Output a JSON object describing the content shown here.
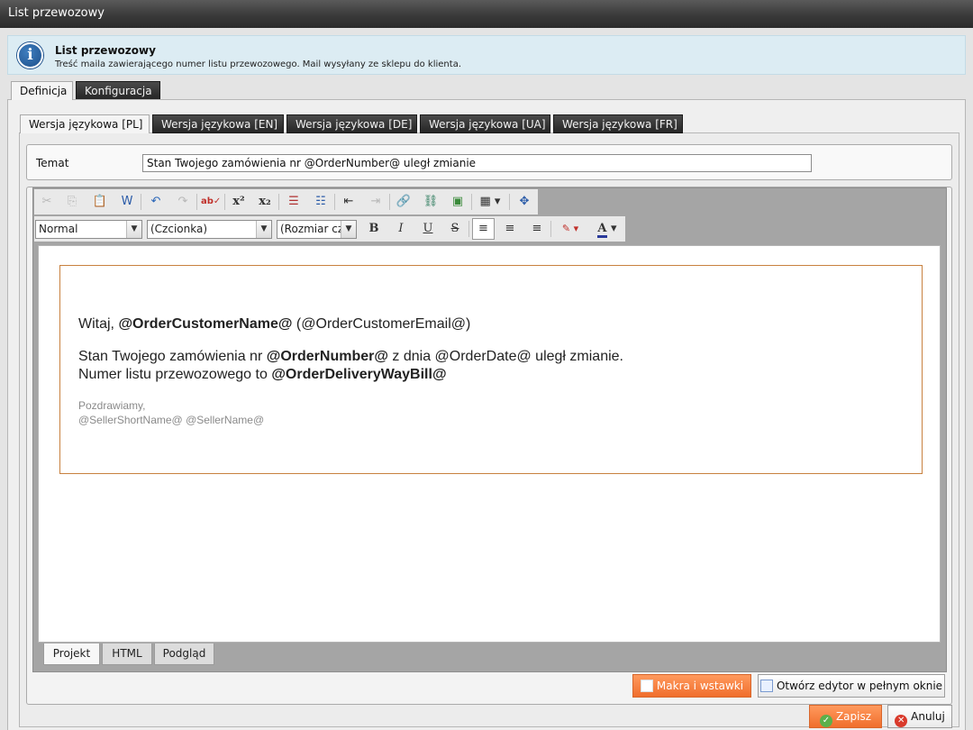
{
  "window": {
    "title": "List przewozowy"
  },
  "info": {
    "title": "List przewozowy",
    "description": "Treść maila zawierającego numer listu przewozowego. Mail wysyłany ze sklepu do klienta."
  },
  "top_tabs": [
    {
      "label": "Definicja",
      "active": true
    },
    {
      "label": "Konfiguracja",
      "active": false
    }
  ],
  "lang_tabs": [
    {
      "label": "Wersja językowa [PL]",
      "active": true
    },
    {
      "label": "Wersja językowa [EN]",
      "active": false
    },
    {
      "label": "Wersja językowa [DE]",
      "active": false
    },
    {
      "label": "Wersja językowa [UA]",
      "active": false
    },
    {
      "label": "Wersja językowa [FR]",
      "active": false
    }
  ],
  "subject": {
    "label": "Temat",
    "value": "Stan Twojego zamówienia nr @OrderNumber@ uległ zmianie"
  },
  "editor": {
    "format_select": "Normal",
    "font_select": "(Czcionka)",
    "size_select": "(Rozmiar czcionki)",
    "mail": {
      "greeting_prefix": "Witaj, ",
      "greeting_name": "@OrderCustomerName@",
      "greeting_email": " (@OrderCustomerEmail@)",
      "line1_prefix": "Stan Twojego zamówienia nr ",
      "line1_number": "@OrderNumber@",
      "line1_suffix": " z dnia @OrderDate@ uległ zmianie.",
      "line2_prefix": "Numer listu przewozowego to ",
      "line2_waybill": "@OrderDeliveryWayBill@",
      "regards": "Pozdrawiamy,",
      "signature": "@SellerShortName@ @SellerName@"
    },
    "bottom_tabs": [
      {
        "label": "Projekt",
        "active": true
      },
      {
        "label": "HTML",
        "active": false
      },
      {
        "label": "Podgląd",
        "active": false
      }
    ]
  },
  "buttons": {
    "macros": "Makra i wstawki",
    "fullscreen": "Otwórz edytor w pełnym oknie",
    "save": "Zapisz",
    "cancel": "Anuluj"
  }
}
